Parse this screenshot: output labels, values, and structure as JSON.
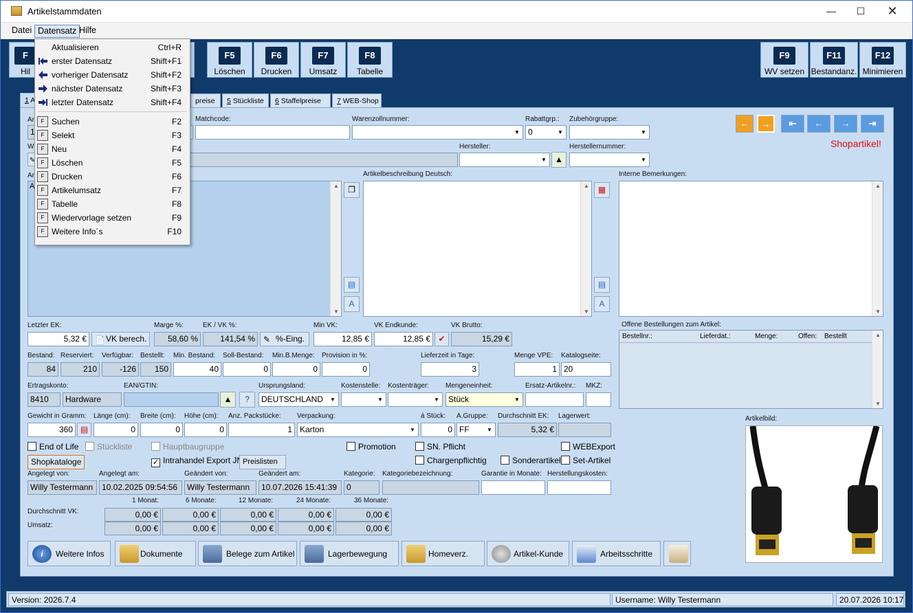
{
  "window": {
    "title": "Artikelstammdaten"
  },
  "menubar": {
    "items": [
      "Datei",
      "Datensatz",
      "Hilfe"
    ]
  },
  "toolbar": {
    "left_partial": {
      "key": "F",
      "label": "Hil"
    },
    "buttons": [
      {
        "key": "F5",
        "label": "Löschen"
      },
      {
        "key": "F6",
        "label": "Drucken"
      },
      {
        "key": "F7",
        "label": "Umsatz"
      },
      {
        "key": "F8",
        "label": "Tabelle"
      },
      {
        "key": "F9",
        "label": "WV setzen"
      },
      {
        "key": "F11",
        "label": "Bestandanz."
      },
      {
        "key": "F12",
        "label": "Minimieren"
      }
    ]
  },
  "dropdown": {
    "items": [
      {
        "label": "Aktualisieren",
        "shortcut": "Ctrl+R"
      },
      {
        "label": "erster Datensatz",
        "shortcut": "Shift+F1"
      },
      {
        "label": "vorheriger Datensatz",
        "shortcut": "Shift+F2"
      },
      {
        "label": "nächster Datensatz",
        "shortcut": "Shift+F3"
      },
      {
        "label": "letzter Datensatz",
        "shortcut": "Shift+F4"
      },
      {
        "label": "Suchen",
        "shortcut": "F2"
      },
      {
        "label": "Selekt",
        "shortcut": "F3"
      },
      {
        "label": "Neu",
        "shortcut": "F4"
      },
      {
        "label": "Löschen",
        "shortcut": "F5"
      },
      {
        "label": "Drucken",
        "shortcut": "F6"
      },
      {
        "label": "Artikelumsatz",
        "shortcut": "F7"
      },
      {
        "label": "Tabelle",
        "shortcut": "F8"
      },
      {
        "label": "Wiedervorlage setzen",
        "shortcut": "F9"
      },
      {
        "label": "Weitere Info´s",
        "shortcut": "F10"
      }
    ]
  },
  "tabs": {
    "t1_num": "1",
    "t1": "A",
    "t_preise": "preise",
    "t5_num": "5",
    "t5": "Stückliste",
    "t6_num": "6",
    "t6": "Staffelpreise",
    "t7_num": "7",
    "t7": "WEB-Shop"
  },
  "form": {
    "partial": {
      "ar1": "Ar",
      "ar1_val": "1(",
      "w": "W",
      "ar2": "Ar",
      "ar2_val": "A"
    },
    "matchcode_label": "Matchcode:",
    "warenzoll_label": "Warenzollnummer:",
    "rabatt_label": "Rabattgrp.:",
    "rabatt_value": "0",
    "zubehoer_label": "Zubehörgruppe:",
    "hersteller_label": "Hersteller:",
    "herstellernr_label": "Herstellernummer:",
    "shopartikel": "Shopartikel!",
    "desc_label": "Artikelbeschreibung Deutsch:",
    "interne_label": "Interne Bemerkungen:",
    "letzter_ek_label": "Letzter EK:",
    "letzter_ek": "5,32 €",
    "vk_berech": "VK berech.",
    "marge_label": "Marge %:",
    "marge": "58,60 %",
    "ekvk_label": "EK / VK %:",
    "ekvk": "141,54 %",
    "prozent_eing": "%-Eing.",
    "minvk_label": "Min VK:",
    "minvk": "12,85 €",
    "vkend_label": "VK Endkunde:",
    "vkend": "12,85 €",
    "vkbrutto_label": "VK Brutto:",
    "vkbrutto": "15,29 €",
    "offene_label": "Offene Bestellungen zum Artikel:",
    "offene_cols": [
      "Bestellnr.:",
      "Lieferdat.:",
      "Menge:",
      "Offen:",
      "Bestellt"
    ],
    "bestand_label": "Bestand:",
    "bestand": "84",
    "reserviert_label": "Reserviert:",
    "reserviert": "210",
    "verfuegbar_label": "Verfügbar:",
    "verfuegbar": "-126",
    "bestellt_label": "Bestellt:",
    "bestellt": "150",
    "minbestand_label": "Min. Bestand:",
    "minbestand": "40",
    "sollbestand_label": "Soll-Bestand:",
    "sollbestand": "0",
    "minbmenge_label": "Min.B.Menge:",
    "minbmenge": "0",
    "provision_label": "Provision in %:",
    "provision": "0",
    "lieferzeit_label": "Lieferzeit in Tage:",
    "lieferzeit": "3",
    "mengevpe_label": "Menge VPE:",
    "mengevpe": "1",
    "katalogseite_label": "Katalogseite:",
    "katalogseite": "20",
    "ertragskonto_label": "Ertragskonto:",
    "ertragskonto": "8410",
    "ertragskonto_name": "Hardware",
    "ean_label": "EAN/GTIN:",
    "ursprungsland_label": "Ursprungsland:",
    "ursprungsland": "DEUTSCHLAND",
    "kostenstelle_label": "Kostenstelle:",
    "kostentraeger_label": "Kostenträger:",
    "mengeneinheit_label": "Mengeneinheit:",
    "mengeneinheit": "Stück",
    "ersatz_label": "Ersatz-Artikelnr.:",
    "mkz_label": "MKZ:",
    "gewicht_label": "Gewicht in Gramm:",
    "gewicht": "360",
    "laenge_label": "Länge (cm):",
    "laenge": "0",
    "breite_label": "Breite (cm):",
    "breite": "0",
    "hoehe_label": "Höhe (cm):",
    "hoehe": "0",
    "packstuecke_label": "Anz. Packstücke:",
    "packstuecke": "1",
    "verpackung_label": "Verpackung:",
    "verpackung": "Karton",
    "astueck_label": "á Stück:",
    "astueck": "0",
    "agruppe_label": "A.Gruppe:",
    "agruppe": "FF",
    "durchek_label": "Durchschnitt EK:",
    "durchek": "5,32 €",
    "lagerwert_label": "Lagerwert:",
    "artikelbild_label": "Artikelbild:",
    "cb_endoflife": "End of Life",
    "cb_stueckliste": "Stückliste",
    "cb_hauptbaugruppe": "Hauptbaugruppe",
    "cb_promotion": "Promotion",
    "cb_snpflicht": "SN. Pflicht",
    "cb_webexport": "WEBExport",
    "shopkataloge": "Shopkataloge",
    "cb_intrahandel": "Intrahandel Export JN",
    "preislisten": "Preislisten",
    "cb_charge": "Chargenpflichtig",
    "cb_sonder": "Sonderartikel",
    "cb_set": "Set-Artikel",
    "angelegtvon_label": "Angelegt von:",
    "angelegtvon": "Willy Testermann",
    "angelegtam_label": "Angelegt am:",
    "angelegtam": "10.02.2025 09:54:56",
    "geaendertvon_label": "Geändert von:",
    "geaendertvon": "Willy Testermann",
    "geaendertam_label": "Geändert am:",
    "geaendertam": "10.07.2026 15:41:39",
    "kategorie_label": "Kategorie:",
    "kategorie": "0",
    "katbez_label": "Kategoriebezeichnung:",
    "garantie_label": "Garantie in Monate:",
    "herstkosten_label": "Herstellungskosten:",
    "months": [
      "1 Monat:",
      "6 Monate:",
      "12 Monate:",
      "24 Monate:",
      "36 Monate:"
    ],
    "dvk_label": "Durchschnitt VK:",
    "umsatz_label": "Umsatz:",
    "dvk_values": [
      "0,00 €",
      "0,00 €",
      "0,00 €",
      "0,00 €",
      "0,00 €"
    ],
    "umsatz_values": [
      "0,00 €",
      "0,00 €",
      "0,00 €",
      "0,00 €",
      "0,00 €"
    ]
  },
  "bottom_buttons": [
    "Weitere Infos",
    "Dokumente",
    "Belege zum Artikel",
    "Lagerbewegung",
    "Homeverz.",
    "Artikel-Kunde",
    "Arbeitsschritte"
  ],
  "status": {
    "version": "Version: 2026.7.4",
    "user": "Username: Willy Testermann",
    "datetime": "20.07.2026 10:17"
  },
  "colors": {
    "accent_red": "#e01010",
    "nav_orange": "#f0a020",
    "nav_blue": "#5b9be0",
    "panel": "#c9ddf2",
    "frame": "#103a6a"
  }
}
